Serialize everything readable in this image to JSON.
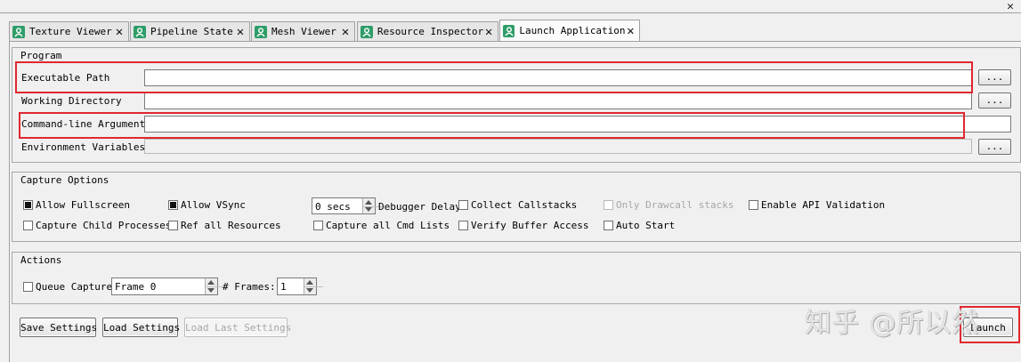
{
  "window": {
    "close_glyph": "✕"
  },
  "tabs": [
    {
      "label": "Texture Viewer",
      "icon": "person-icon",
      "close": "✕"
    },
    {
      "label": "Pipeline State",
      "icon": "person-icon",
      "close": "✕"
    },
    {
      "label": "Mesh Viewer",
      "icon": "person-icon",
      "close": "✕"
    },
    {
      "label": "Resource Inspector",
      "icon": "person-icon",
      "close": "✕"
    },
    {
      "label": "Launch Application",
      "icon": "person-icon",
      "close": "✕",
      "active": true
    }
  ],
  "program": {
    "title": "Program",
    "executable_path": {
      "label": "Executable Path",
      "value": "",
      "browse": "..."
    },
    "working_directory": {
      "label": "Working Directory",
      "value": "",
      "browse": "..."
    },
    "cmdline_args": {
      "label": "Command-line Arguments",
      "value": ""
    },
    "env_vars": {
      "label": "Environment Variables",
      "value": "",
      "browse": "..."
    }
  },
  "capture_options": {
    "title": "Capture Options",
    "allow_fullscreen": {
      "label": "Allow Fullscreen",
      "checked": true
    },
    "allow_vsync": {
      "label": "Allow VSync",
      "checked": true
    },
    "debugger_delay": {
      "value": "0 secs",
      "label": "Debugger Delay"
    },
    "collect_callstacks": {
      "label": "Collect Callstacks",
      "checked": false
    },
    "only_drawcall_stacks": {
      "label": "Only Drawcall stacks",
      "checked": false,
      "disabled": true
    },
    "enable_api_validation": {
      "label": "Enable API Validation",
      "checked": false
    },
    "capture_child_processes": {
      "label": "Capture Child Processes",
      "checked": false
    },
    "ref_all_resources": {
      "label": "Ref all Resources",
      "checked": false
    },
    "capture_all_cmd_lists": {
      "label": "Capture all Cmd Lists",
      "checked": false
    },
    "verify_buffer_access": {
      "label": "Verify Buffer Access",
      "checked": false
    },
    "auto_start": {
      "label": "Auto Start",
      "checked": false
    }
  },
  "actions": {
    "title": "Actions",
    "queue_capture": {
      "label": "Queue Capture",
      "checked": false
    },
    "frame": {
      "value": "Frame 0"
    },
    "num_frames": {
      "label": "# Frames:",
      "value": "1"
    }
  },
  "buttons": {
    "save": "Save Settings",
    "load": "Load Settings",
    "load_last": "Load Last Settings",
    "launch": "Launch"
  },
  "watermark": "知乎 @所以然",
  "colors": {
    "highlight_red": "#e0282f",
    "tab_icon_green": "#2f9d68"
  }
}
